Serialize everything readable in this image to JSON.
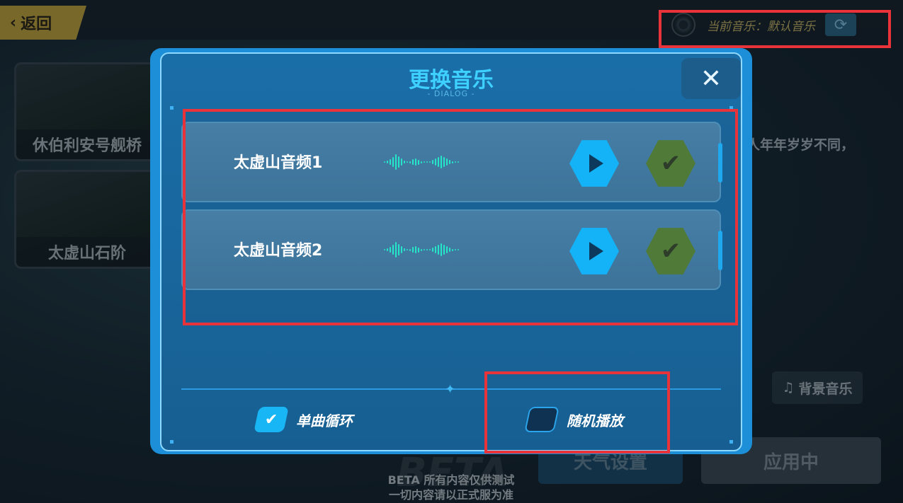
{
  "header": {
    "back_label": "返回",
    "current_music_label": "当前音乐：默认音乐"
  },
  "scenes": [
    {
      "label": "休伯利安号舰桥"
    },
    {
      "label": "太虚山石阶"
    }
  ],
  "background": {
    "description_fragment": "人年年岁岁不同，",
    "music_tab_label": "背景音乐",
    "weather_button": "天气设置",
    "apply_button": "应用中",
    "beta_line1": "BETA 所有内容仅供测试",
    "beta_line2": "一切内容请以正式服为准",
    "beta_watermark": "BETA"
  },
  "dialog": {
    "title": "更换音乐",
    "subtitle": "- DIALOG -",
    "close_icon": "close-icon",
    "tracks": [
      {
        "name": "太虚山音频1",
        "selected": false
      },
      {
        "name": "太虚山音频2",
        "selected": false
      }
    ],
    "options": {
      "loop_label": "单曲循环",
      "loop_checked": true,
      "shuffle_label": "随机播放",
      "shuffle_checked": false
    }
  },
  "colors": {
    "dialog_accent": "#3ed0ff",
    "play_button": "#14b3f7",
    "select_button": "#4f7a38",
    "waveform": "#25e6c9",
    "highlight": "#e8333a"
  }
}
